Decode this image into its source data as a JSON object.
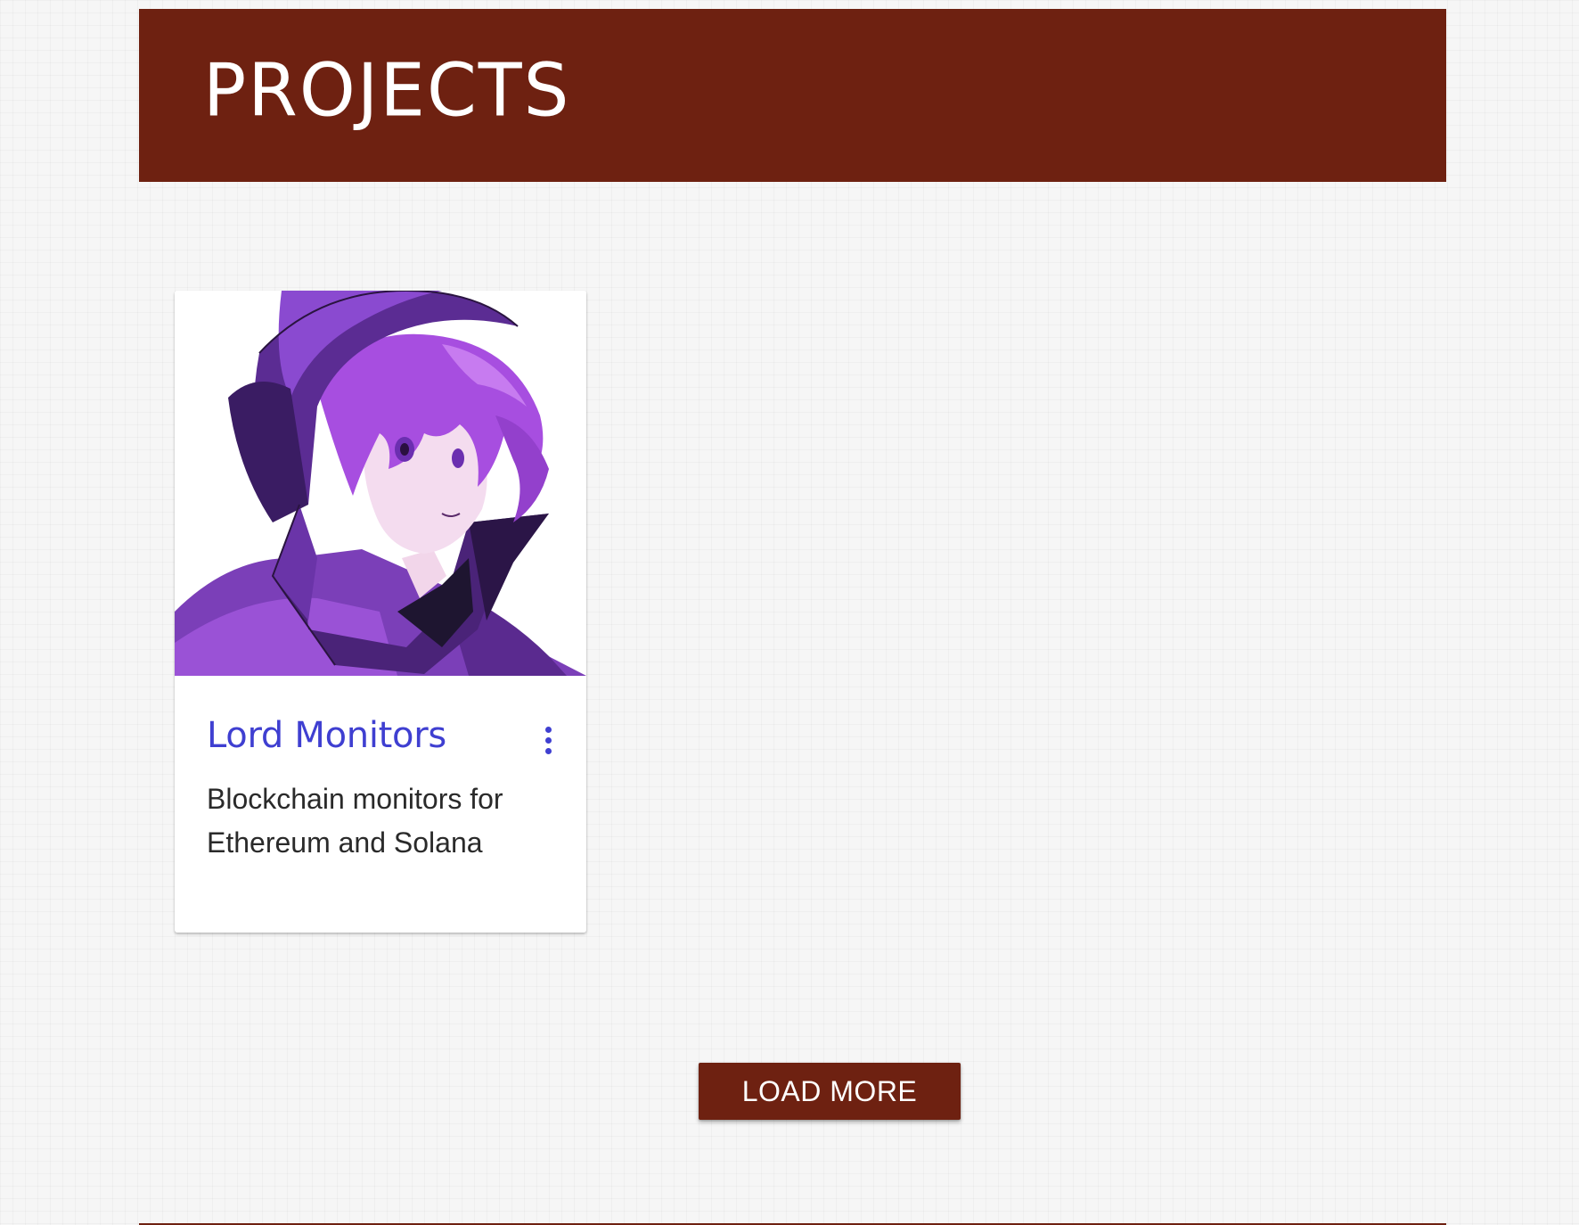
{
  "header": {
    "title": "PROJECTS"
  },
  "projects": [
    {
      "title": "Lord Monitors",
      "description": "Blockchain monitors for Ethereum and Solana",
      "image": "anime-character-purple-hood-portrait",
      "menu_icon": "more-vert-icon"
    }
  ],
  "actions": {
    "load_more_label": "LOAD MORE"
  },
  "colors": {
    "brand": "#6e2111",
    "link": "#3f3fd1",
    "background": "#f6f6f6",
    "text": "#2a2a2a"
  }
}
